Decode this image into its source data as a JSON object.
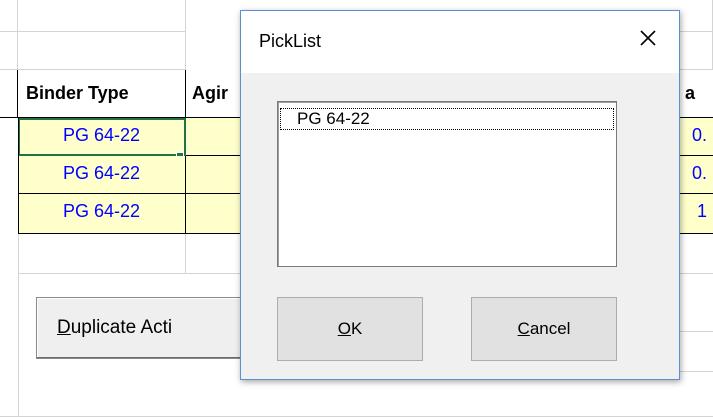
{
  "sheet": {
    "headers": {
      "binder_type": "Binder Type",
      "aging": "Agir",
      "partial_right": "f a"
    },
    "rows": [
      {
        "binder": "PG 64-22",
        "right_value": "0."
      },
      {
        "binder": "PG 64-22",
        "right_value": "0."
      },
      {
        "binder": "PG 64-22",
        "right_value": "1"
      }
    ],
    "button": {
      "first_letter": "D",
      "rest": "uplicate Acti"
    }
  },
  "dialog": {
    "title": "PickList",
    "close_icon": "close-icon",
    "list_items": [
      "PG 64-22"
    ],
    "ok": {
      "mnemonic": "O",
      "rest": "K"
    },
    "cancel": {
      "mnemonic": "C",
      "rest": "ancel"
    }
  },
  "colors": {
    "data_fill": "#ffffcc",
    "data_text": "#0000ff",
    "selection": "#217346",
    "dialog_border": "#5a8fd0"
  }
}
